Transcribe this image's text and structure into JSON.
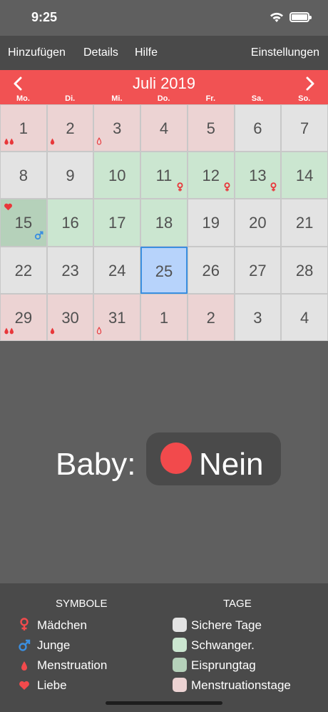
{
  "status": {
    "time": "9:25"
  },
  "toolbar": {
    "add": "Hinzufügen",
    "details": "Details",
    "help": "Hilfe",
    "settings": "Einstellungen"
  },
  "calendar": {
    "month_title": "Juli 2019",
    "weekdays": [
      "Mo.",
      "Di.",
      "Mi.",
      "Do.",
      "Fr.",
      "Sa.",
      "So."
    ],
    "weeks": [
      [
        {
          "day": "1",
          "type": "mens",
          "symbols": [
            "drop-double"
          ]
        },
        {
          "day": "2",
          "type": "mens",
          "symbols": [
            "drop"
          ]
        },
        {
          "day": "3",
          "type": "mens",
          "symbols": [
            "drop-outline"
          ]
        },
        {
          "day": "4",
          "type": "mens",
          "symbols": []
        },
        {
          "day": "5",
          "type": "mens",
          "symbols": []
        },
        {
          "day": "6",
          "type": "safe",
          "symbols": []
        },
        {
          "day": "7",
          "type": "safe",
          "symbols": []
        }
      ],
      [
        {
          "day": "8",
          "type": "safe",
          "symbols": []
        },
        {
          "day": "9",
          "type": "safe",
          "symbols": []
        },
        {
          "day": "10",
          "type": "preg",
          "symbols": []
        },
        {
          "day": "11",
          "type": "preg",
          "symbols": [
            "female"
          ]
        },
        {
          "day": "12",
          "type": "preg",
          "symbols": [
            "female"
          ]
        },
        {
          "day": "13",
          "type": "preg",
          "symbols": [
            "female"
          ]
        },
        {
          "day": "14",
          "type": "preg",
          "symbols": []
        }
      ],
      [
        {
          "day": "15",
          "type": "ovul",
          "symbols": [
            "heart",
            "male"
          ]
        },
        {
          "day": "16",
          "type": "preg",
          "symbols": []
        },
        {
          "day": "17",
          "type": "preg",
          "symbols": []
        },
        {
          "day": "18",
          "type": "preg",
          "symbols": []
        },
        {
          "day": "19",
          "type": "safe",
          "symbols": []
        },
        {
          "day": "20",
          "type": "safe",
          "symbols": []
        },
        {
          "day": "21",
          "type": "safe",
          "symbols": []
        }
      ],
      [
        {
          "day": "22",
          "type": "safe",
          "symbols": []
        },
        {
          "day": "23",
          "type": "safe",
          "symbols": []
        },
        {
          "day": "24",
          "type": "safe",
          "symbols": []
        },
        {
          "day": "25",
          "type": "selected",
          "symbols": []
        },
        {
          "day": "26",
          "type": "safe",
          "symbols": []
        },
        {
          "day": "27",
          "type": "safe",
          "symbols": []
        },
        {
          "day": "28",
          "type": "safe",
          "symbols": []
        }
      ],
      [
        {
          "day": "29",
          "type": "mens",
          "symbols": [
            "drop-double"
          ]
        },
        {
          "day": "30",
          "type": "mens",
          "symbols": [
            "drop"
          ]
        },
        {
          "day": "31",
          "type": "mens",
          "symbols": [
            "drop-outline"
          ]
        },
        {
          "day": "1",
          "type": "mens",
          "symbols": []
        },
        {
          "day": "2",
          "type": "mens",
          "symbols": []
        },
        {
          "day": "3",
          "type": "safe",
          "symbols": []
        },
        {
          "day": "4",
          "type": "safe",
          "symbols": []
        }
      ]
    ]
  },
  "baby": {
    "label": "Baby:",
    "value": "Nein"
  },
  "legend": {
    "symbols_title": "SYMBOLE",
    "days_title": "TAGE",
    "symbols": [
      {
        "icon": "female-icon",
        "label": "Mädchen"
      },
      {
        "icon": "male-icon",
        "label": "Junge"
      },
      {
        "icon": "drop-icon",
        "label": "Menstruation"
      },
      {
        "icon": "heart-icon",
        "label": "Liebe"
      }
    ],
    "days": [
      {
        "label": "Sichere Tage",
        "color": "#e3e3e3"
      },
      {
        "label": "Schwanger.",
        "color": "#cbe6d0"
      },
      {
        "label": "Eisprungtag",
        "color": "#b5d1ba"
      },
      {
        "label": "Menstruationstage",
        "color": "#ecd3d3"
      }
    ]
  },
  "colors": {
    "accent": "#f15253",
    "male": "#3b8fe0",
    "selected": "#b7d3fb"
  }
}
